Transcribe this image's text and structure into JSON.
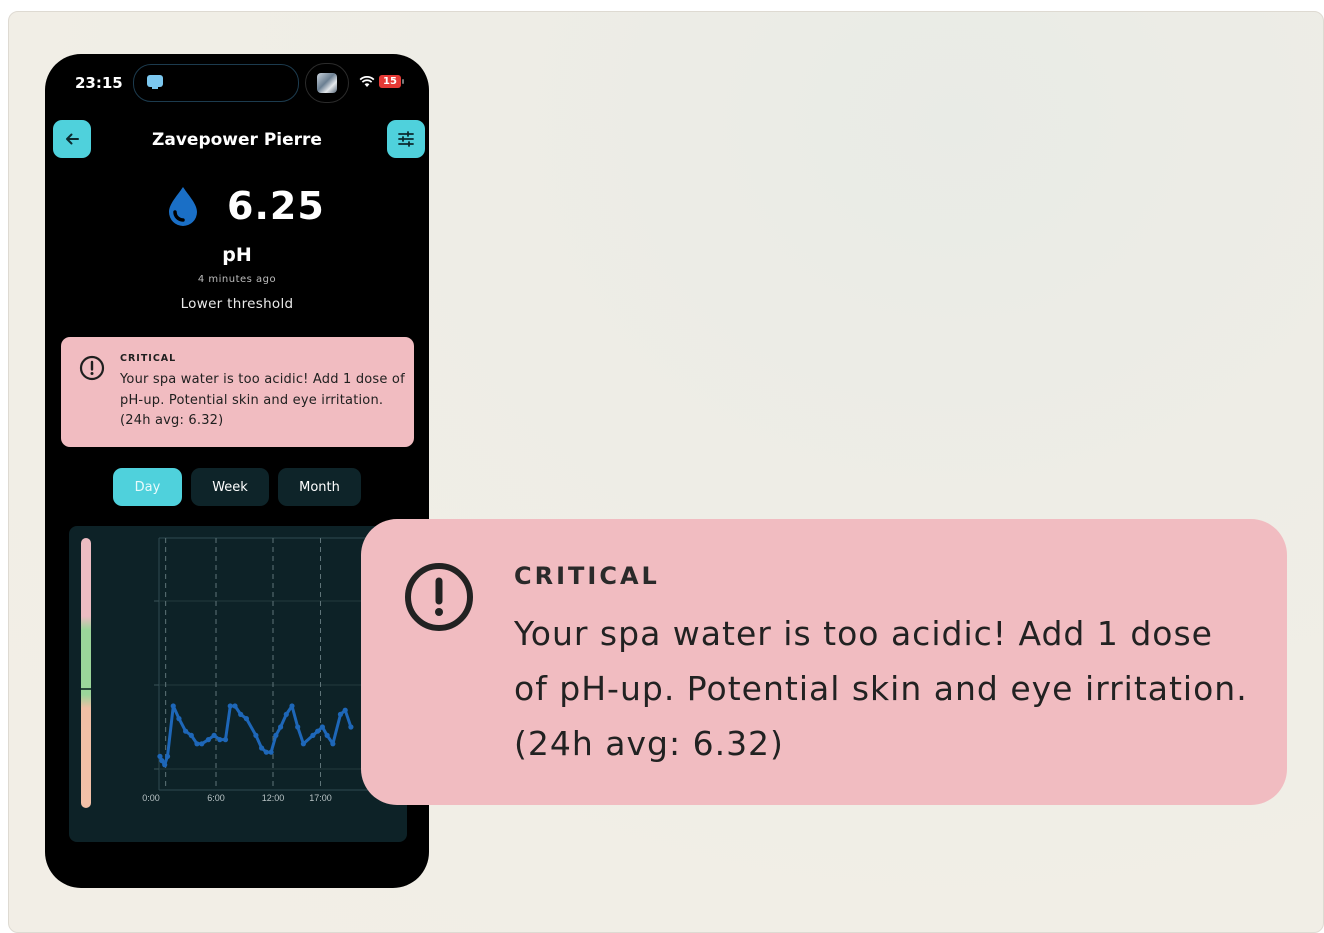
{
  "status_bar": {
    "time": "23:15",
    "battery": "15"
  },
  "header": {
    "title": "Zavepower Pierre"
  },
  "reading": {
    "value": "6.25",
    "unit": "pH",
    "updated": "4 minutes ago",
    "status": "Lower threshold"
  },
  "alert": {
    "level": "CRITICAL",
    "message": "Your spa water is too acidic! Add 1 dose of pH-up. Potential skin and eye irritation. (24h avg: 6.32)"
  },
  "range_tabs": [
    {
      "label": "Day",
      "selected": true
    },
    {
      "label": "Week",
      "selected": false
    },
    {
      "label": "Month",
      "selected": false
    }
  ],
  "chart_data": {
    "type": "line",
    "title": "",
    "x_tick_labels": [
      "0:00",
      "6:00",
      "12:00",
      "17:00"
    ],
    "x_hours": [
      0.1,
      0.3,
      0.6,
      0.9,
      1.5,
      2.1,
      2.8,
      3.4,
      4.0,
      4.5,
      5.2,
      5.8,
      6.4,
      7.0,
      7.5,
      8.0,
      8.6,
      9.2,
      10.2,
      10.8,
      11.3,
      11.8,
      12.3,
      12.8,
      13.4,
      14.0,
      14.6,
      15.2,
      16.2,
      16.7,
      17.2,
      17.7,
      18.3,
      19.1,
      19.6,
      20.2
    ],
    "values": [
      6.03,
      6.02,
      6.01,
      6.03,
      6.15,
      6.12,
      6.09,
      6.08,
      6.06,
      6.06,
      6.07,
      6.08,
      6.07,
      6.07,
      6.15,
      6.15,
      6.13,
      6.12,
      6.08,
      6.05,
      6.04,
      6.04,
      6.08,
      6.1,
      6.13,
      6.15,
      6.1,
      6.06,
      6.08,
      6.09,
      6.1,
      6.08,
      6.06,
      6.13,
      6.14,
      6.1
    ],
    "y_range": [
      5.95,
      6.55
    ],
    "color": "#1e67b8",
    "background": "#0d2227",
    "grid": true
  },
  "colors": {
    "accent": "#4fd1dc",
    "alert_bg": "#f1bcc1",
    "drop": "#1a6fc6"
  }
}
